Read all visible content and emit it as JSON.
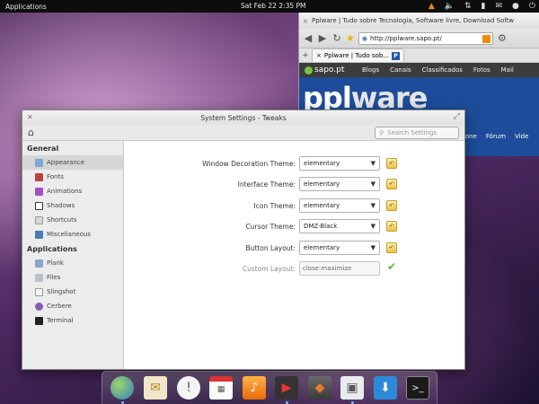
{
  "top_panel": {
    "applications_label": "Applications",
    "clock": "Sat Feb 22  2:35 PM",
    "tray_icons": [
      "vlc-icon",
      "volume-icon",
      "network-icon",
      "battery-icon",
      "mail-icon",
      "user-icon",
      "power-icon"
    ]
  },
  "browser": {
    "window_title": "Pplware | Tudo sobre Tecnologia, Software livre, Download Softw",
    "url": "http://pplware.sapo.pt/",
    "tab_label": "Pplware | Tudo sob...",
    "sapo_logo": "sapo.pt",
    "sapo_nav": [
      "Blogs",
      "Canais",
      "Classificados",
      "Fotos",
      "Mail"
    ],
    "site_logo_ppl": "ppl",
    "site_logo_ware": "ware",
    "site_nav": [
      "rione",
      "Fórum",
      "Vide"
    ]
  },
  "settings": {
    "window_title": "System Settings - Tweaks",
    "search_placeholder": "Search Settings",
    "sidebar": {
      "general_header": "General",
      "general_items": [
        "Appearance",
        "Fonts",
        "Animations",
        "Shadows",
        "Shortcuts",
        "Miscellaneous"
      ],
      "applications_header": "Applications",
      "application_items": [
        "Plank",
        "Files",
        "Slingshot",
        "Cerbere",
        "Terminal"
      ]
    },
    "rows": [
      {
        "label": "Window Decoration Theme:",
        "value": "elementary"
      },
      {
        "label": "Interface Theme:",
        "value": "elementary"
      },
      {
        "label": "Icon Theme:",
        "value": "elementary"
      },
      {
        "label": "Cursor Theme:",
        "value": "DMZ-Black"
      },
      {
        "label": "Button Layout:",
        "value": "elementary"
      }
    ],
    "custom_layout": {
      "label": "Custom Layout:",
      "value": "close:maximize"
    }
  },
  "dock": {
    "apps": [
      "browser-icon",
      "mail-icon",
      "chat-icon",
      "calendar-icon",
      "music-icon",
      "video-icon",
      "photos-icon",
      "settings-icon",
      "downloads-icon",
      "terminal-icon"
    ]
  },
  "colors": {
    "accent": "#1d4d9a",
    "sapo_green": "#7cc242",
    "vlc_orange": "#f08a0c",
    "check_green": "#5ab834"
  }
}
